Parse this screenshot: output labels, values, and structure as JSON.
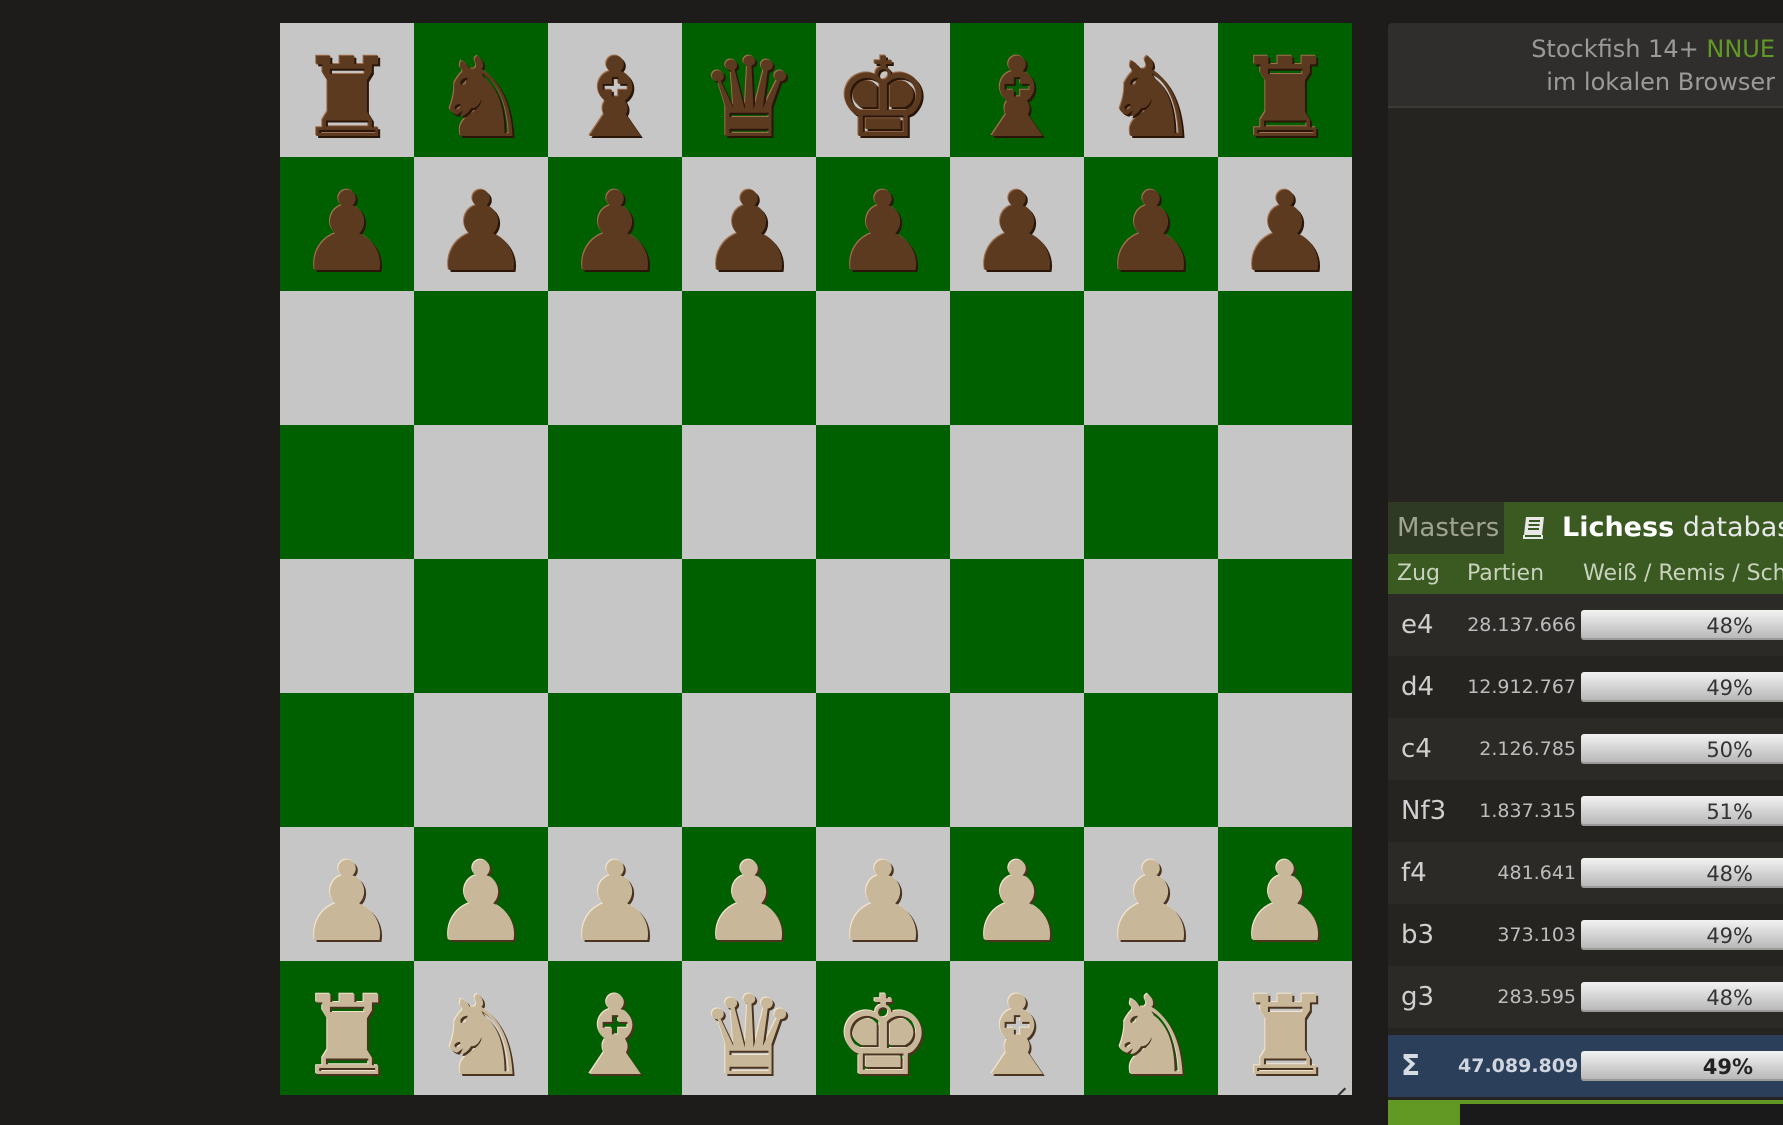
{
  "board": {
    "ranks": [
      [
        "♜",
        "♞",
        "♝",
        "♛",
        "♚",
        "♝",
        "♞",
        "♜"
      ],
      [
        "♟",
        "♟",
        "♟",
        "♟",
        "♟",
        "♟",
        "♟",
        "♟"
      ],
      [
        "",
        "",
        "",
        "",
        "",
        "",
        "",
        ""
      ],
      [
        "",
        "",
        "",
        "",
        "",
        "",
        "",
        ""
      ],
      [
        "",
        "",
        "",
        "",
        "",
        "",
        "",
        ""
      ],
      [
        "",
        "",
        "",
        "",
        "",
        "",
        "",
        ""
      ],
      [
        "♟",
        "♟",
        "♟",
        "♟",
        "♟",
        "♟",
        "♟",
        "♟"
      ],
      [
        "♜",
        "♞",
        "♝",
        "♛",
        "♚",
        "♝",
        "♞",
        "♜"
      ]
    ],
    "colors": [
      "black",
      "black",
      "none",
      "none",
      "none",
      "none",
      "white",
      "white"
    ],
    "light_color": "#c6c6c6",
    "dark_color": "#006000"
  },
  "engine": {
    "name": "Stockfish 14+",
    "variant": "NNUE",
    "location": "im lokalen Browser"
  },
  "explorer": {
    "tabs": {
      "masters": "Masters",
      "lichess_bold": "Lichess",
      "lichess_rest": "database"
    },
    "columns": {
      "move": "Zug",
      "games": "Partien",
      "result": "Weiß / Remis / Schwarz"
    },
    "moves": [
      {
        "move": "e4",
        "games": "28.137.666",
        "white": "48%"
      },
      {
        "move": "d4",
        "games": "12.912.767",
        "white": "49%"
      },
      {
        "move": "c4",
        "games": "2.126.785",
        "white": "50%"
      },
      {
        "move": "Nf3",
        "games": "1.837.315",
        "white": "51%"
      },
      {
        "move": "f4",
        "games": "481.641",
        "white": "48%"
      },
      {
        "move": "b3",
        "games": "373.103",
        "white": "49%"
      },
      {
        "move": "g3",
        "games": "283.595",
        "white": "48%"
      }
    ],
    "total": {
      "symbol": "Σ",
      "games": "47.089.809",
      "white": "49%"
    }
  }
}
